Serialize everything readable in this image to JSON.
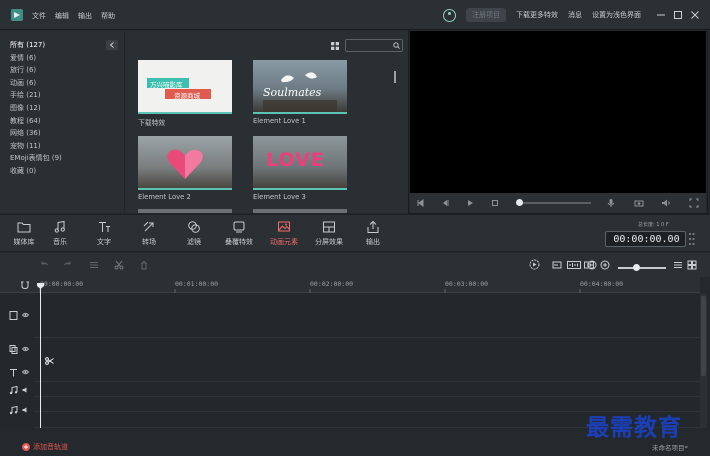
{
  "menu": [
    "文件",
    "编辑",
    "输出",
    "帮助"
  ],
  "header": {
    "active_button": "注册项目",
    "links": [
      "下载更多特效",
      "消息",
      "设置为浅色界面"
    ]
  },
  "library": {
    "categories": [
      {
        "label": "所有 (127)",
        "active": true
      },
      {
        "label": "爱情 (6)"
      },
      {
        "label": "旅行 (6)"
      },
      {
        "label": "动画 (6)"
      },
      {
        "label": "手绘 (21)"
      },
      {
        "label": "图像 (12)"
      },
      {
        "label": "教程 (64)"
      },
      {
        "label": "网络 (36)"
      },
      {
        "label": "宠物 (11)"
      },
      {
        "label": "EMoji表情包 (9)"
      },
      {
        "label": "收藏 (0)"
      }
    ],
    "search": {
      "value": ""
    },
    "cards": [
      {
        "label": "下载特效",
        "thumb_line1": "万兴喵影库",
        "thumb_line2": "资源商城"
      },
      {
        "label": "Element Love 1",
        "thumb_text": "Soulmates"
      },
      {
        "label": "Element Love 2"
      },
      {
        "label": "Element Love 3",
        "thumb_text": "LOVE"
      }
    ]
  },
  "toolbar": [
    {
      "label": "媒体库",
      "icon": "folder-icon"
    },
    {
      "label": "音乐",
      "icon": "music-note-icon"
    },
    {
      "label": "文字",
      "icon": "text-icon"
    },
    {
      "label": "转场",
      "icon": "transition-icon"
    },
    {
      "label": "滤镜",
      "icon": "filter-icon"
    },
    {
      "label": "叠覆特效",
      "icon": "overlay-icon"
    },
    {
      "label": "动画元素",
      "icon": "element-icon",
      "active": true
    },
    {
      "label": "分屏效果",
      "icon": "split-screen-icon"
    },
    {
      "label": "输出",
      "icon": "export-icon"
    }
  ],
  "timecode": {
    "label": "总长度: 1 0 F",
    "value": "00:00:00.00"
  },
  "timeline": {
    "ruler": [
      "00:00:00:00",
      "00:01:00:00",
      "00:02:00:00",
      "00:03:00:00",
      "00:04:00:00"
    ],
    "add_track_label": "添加音轨道",
    "project_name": "未命名项目*"
  },
  "watermark": "最需教育",
  "colors": {
    "accent": "#5cc4b3",
    "active_red": "#f06b6b",
    "add_red": "#e0554f",
    "watermark_blue": "#1b3fb8"
  }
}
